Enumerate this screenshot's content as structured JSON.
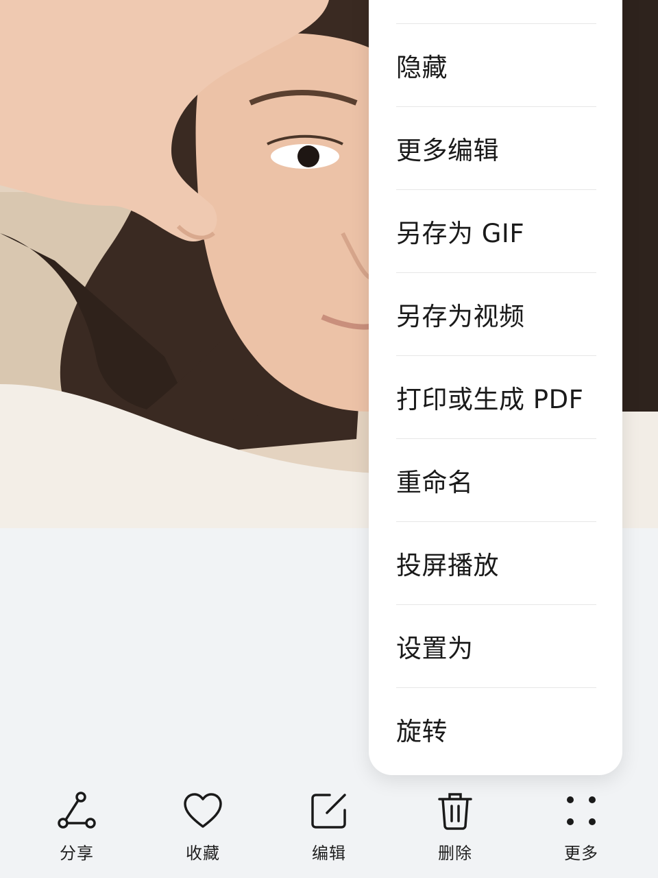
{
  "menu": {
    "items": [
      {
        "label": "隐藏"
      },
      {
        "label": "更多编辑"
      },
      {
        "label": "另存为 GIF"
      },
      {
        "label": "另存为视频"
      },
      {
        "label": "打印或生成 PDF"
      },
      {
        "label": "重命名"
      },
      {
        "label": "投屏播放"
      },
      {
        "label": "设置为"
      },
      {
        "label": "旋转"
      }
    ]
  },
  "toolbar": {
    "items": [
      {
        "label": "分享",
        "icon": "share-icon"
      },
      {
        "label": "收藏",
        "icon": "heart-icon"
      },
      {
        "label": "编辑",
        "icon": "edit-icon"
      },
      {
        "label": "删除",
        "icon": "trash-icon"
      },
      {
        "label": "更多",
        "icon": "more-dots-icon"
      }
    ]
  },
  "colors": {
    "background": "#f1f3f5",
    "menu_bg": "#ffffff",
    "text": "#1a1a1a",
    "divider": "#e6e6e6"
  }
}
